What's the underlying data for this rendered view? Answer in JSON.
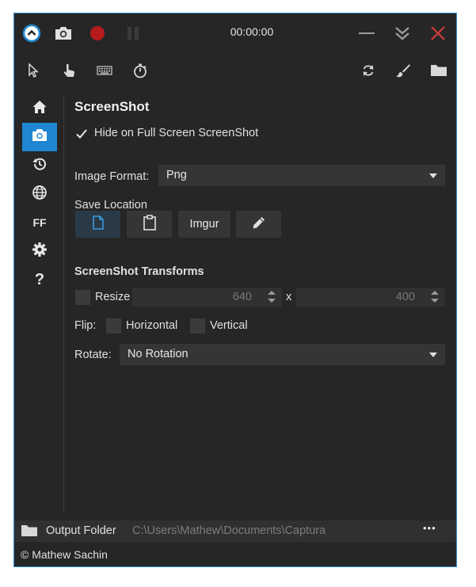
{
  "titlebar": {
    "timer": "00:00:00",
    "icons": [
      "collapse-icon",
      "camera-icon",
      "record-icon",
      "pause-icon",
      "minimize-icon",
      "double-chevron-down-icon",
      "close-icon"
    ]
  },
  "toolbar": {
    "icons": [
      "cursor-icon",
      "hand-click-icon",
      "keyboard-icon",
      "stopwatch-icon",
      "refresh-icon",
      "brush-icon",
      "folder-icon"
    ]
  },
  "sidebar": {
    "items": [
      {
        "name": "home-icon"
      },
      {
        "name": "camera-icon",
        "active": true
      },
      {
        "name": "history-icon"
      },
      {
        "name": "globe-icon"
      },
      {
        "label": "FF"
      },
      {
        "name": "gear-icon"
      },
      {
        "label": "?"
      }
    ]
  },
  "screenshot": {
    "title": "ScreenShot",
    "hide_fullscreen_label": "Hide on Full Screen ScreenShot",
    "hide_fullscreen_checked": true,
    "image_format_label": "Image Format:",
    "image_format_value": "Png",
    "save_location_label": "Save Location",
    "save_buttons": {
      "file": "file-icon",
      "clipboard": "clipboard-icon",
      "imgur": "Imgur",
      "editor": "pencil-icon"
    }
  },
  "transforms": {
    "title": "ScreenShot Transforms",
    "resize_label": "Resize",
    "resize_checked": false,
    "width": "640",
    "by": "x",
    "height": "400",
    "flip_label": "Flip:",
    "horizontal_label": "Horizontal",
    "vertical_label": "Vertical",
    "rotate_label": "Rotate:",
    "rotate_value": "No Rotation"
  },
  "footer": {
    "output_folder_label": "Output Folder",
    "output_path": "C:\\Users\\Mathew\\Documents\\Captura",
    "more": "•••",
    "copyright": "© Mathew Sachin"
  },
  "colors": {
    "accent": "#1f87d1",
    "record": "#c11e1e",
    "close": "#c23a3a",
    "window_bg": "#262626"
  }
}
